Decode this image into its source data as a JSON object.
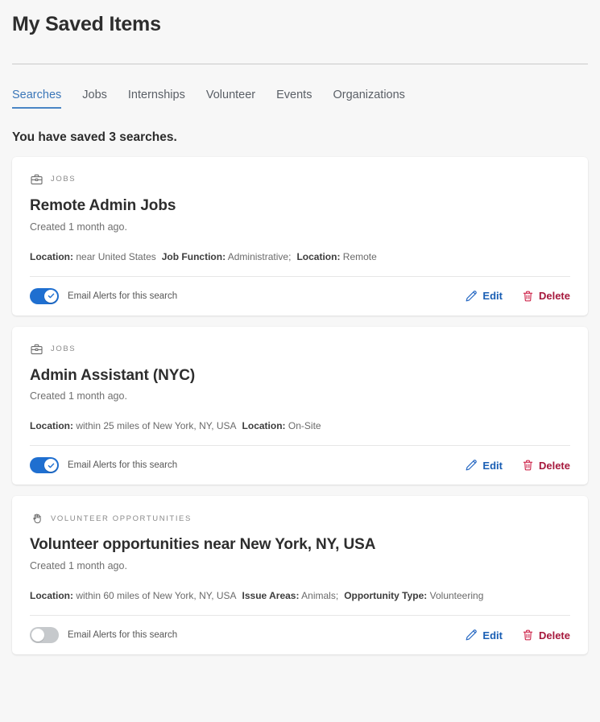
{
  "header": {
    "title": "My Saved Items"
  },
  "tabs": [
    {
      "label": "Searches",
      "active": true
    },
    {
      "label": "Jobs",
      "active": false
    },
    {
      "label": "Internships",
      "active": false
    },
    {
      "label": "Volunteer",
      "active": false
    },
    {
      "label": "Events",
      "active": false
    },
    {
      "label": "Organizations",
      "active": false
    }
  ],
  "saved_count_text": "You have saved 3 searches.",
  "alerts_label": "Email Alerts for this search",
  "actions": {
    "edit_label": "Edit",
    "delete_label": "Delete"
  },
  "colors": {
    "accent_blue": "#3a76b8",
    "toggle_on": "#1f6fd0",
    "toggle_off": "#c6c9cc",
    "edit_blue": "#1a5fb4",
    "delete_red": "#a6183c",
    "page_background": "#f7f7f7",
    "card_background": "#ffffff"
  },
  "cards": [
    {
      "kicker": "JOBS",
      "kicker_icon": "briefcase-icon",
      "title": "Remote Admin Jobs",
      "created": "Created 1 month ago.",
      "filters": [
        {
          "label": "Location:",
          "value": "near United States",
          "separator": ""
        },
        {
          "label": "Job Function:",
          "value": "Administrative",
          "separator": ";"
        },
        {
          "label": "Location:",
          "value": "Remote",
          "separator": ""
        }
      ],
      "alerts_on": true
    },
    {
      "kicker": "JOBS",
      "kicker_icon": "briefcase-icon",
      "title": "Admin Assistant (NYC)",
      "created": "Created 1 month ago.",
      "filters": [
        {
          "label": "Location:",
          "value": "within 25 miles of New York, NY, USA",
          "separator": ""
        },
        {
          "label": "Location:",
          "value": "On-Site",
          "separator": ""
        }
      ],
      "alerts_on": true
    },
    {
      "kicker": "VOLUNTEER OPPORTUNITIES",
      "kicker_icon": "hand-icon",
      "title": "Volunteer opportunities near New York, NY, USA",
      "created": "Created 1 month ago.",
      "filters": [
        {
          "label": "Location:",
          "value": "within 60 miles of New York, NY, USA",
          "separator": ""
        },
        {
          "label": "Issue Areas:",
          "value": "Animals",
          "separator": ";"
        },
        {
          "label": "Opportunity Type:",
          "value": "Volunteering",
          "separator": ""
        }
      ],
      "alerts_on": false
    }
  ]
}
